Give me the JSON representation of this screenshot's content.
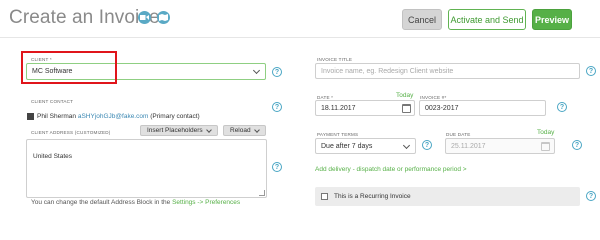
{
  "header": {
    "title": "Create an Invoice",
    "buttons": {
      "cancel": "Cancel",
      "activate": "Activate and Send",
      "preview": "Preview"
    }
  },
  "icons": {
    "video": "video-camera-icon",
    "map": "map-icon",
    "help": "help-icon",
    "calendar": "calendar-icon",
    "dropdown": "chevron-down-icon"
  },
  "left": {
    "client": {
      "label": "CLIENT *",
      "value": "MC Software"
    },
    "client_contact": {
      "label": "CLIENT CONTACT",
      "name": "Phil Sherman",
      "email": "aSHYjohGJb@fake.com",
      "suffix": "(Primary contact)"
    },
    "client_address": {
      "label": "CLIENT ADDRESS (CUSTOMIZED)",
      "insert_placeholders": "Insert Placeholders",
      "reload": "Reload",
      "value": "United States"
    },
    "footnote": {
      "text": "You can change the default Address Block in the",
      "link": "Settings -> Preferences"
    }
  },
  "right": {
    "invoice_title": {
      "label": "INVOICE TITLE",
      "placeholder": "Invoice name, eg. Redesign Client website"
    },
    "date": {
      "label": "DATE *",
      "today": "Today",
      "value": "18.11.2017"
    },
    "invoice_number": {
      "label": "INVOICE #*",
      "value": "0023-2017"
    },
    "payment_terms": {
      "label": "PAYMENT TERMS",
      "value": "Due after 7 days"
    },
    "due_date": {
      "label": "DUE DATE",
      "today": "Today",
      "value": "25.11.2017"
    },
    "add_delivery": "Add delivery - dispatch date or performance period >",
    "recurring": "This is a Recurring Invoice"
  },
  "help_glyph": "?",
  "colors": {
    "accent_green": "#56b047",
    "help_blue": "#4aa6c4",
    "highlight_red": "#e0151b"
  }
}
